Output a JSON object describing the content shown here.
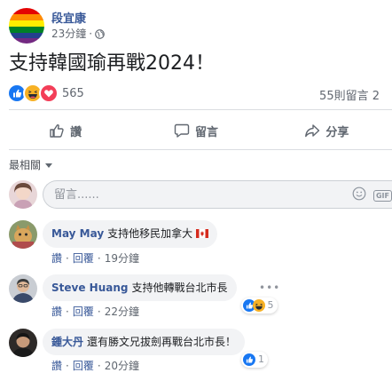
{
  "post": {
    "author": "段宜康",
    "time": "23分鐘",
    "separator": "·",
    "privacy_icon": "globe-icon",
    "text": "支持韓國瑜再戰2024！"
  },
  "reactions": {
    "icons": [
      "like-icon",
      "haha-icon",
      "love-icon"
    ],
    "count": "565",
    "comments": "55則留言 2"
  },
  "actions": {
    "like_label": "讚",
    "comment_label": "留言",
    "share_label": "分享"
  },
  "sort": {
    "label": "最相關"
  },
  "compose": {
    "placeholder": "留言......"
  },
  "comments": [
    {
      "name": "May May",
      "text": "支持他移民加拿大",
      "flag": "canada-flag-icon",
      "like": "讚",
      "reply": "回覆",
      "time": "19分鐘"
    },
    {
      "name": "Steve Huang",
      "text": "支持他轉戰台北市長",
      "like": "讚",
      "reply": "回覆",
      "time": "22分鐘",
      "reaction_count": "5"
    },
    {
      "name": "鍾大丹",
      "text": "還有勝文兄拔劍再戰台北市長！",
      "like": "讚",
      "reply": "回覆",
      "time": "20分鐘",
      "reaction_count": "1"
    }
  ],
  "colors": {
    "link": "#385898",
    "like_blue": "#1877f2",
    "love_red": "#f33e58",
    "haha_yellow": "#f7b125"
  }
}
